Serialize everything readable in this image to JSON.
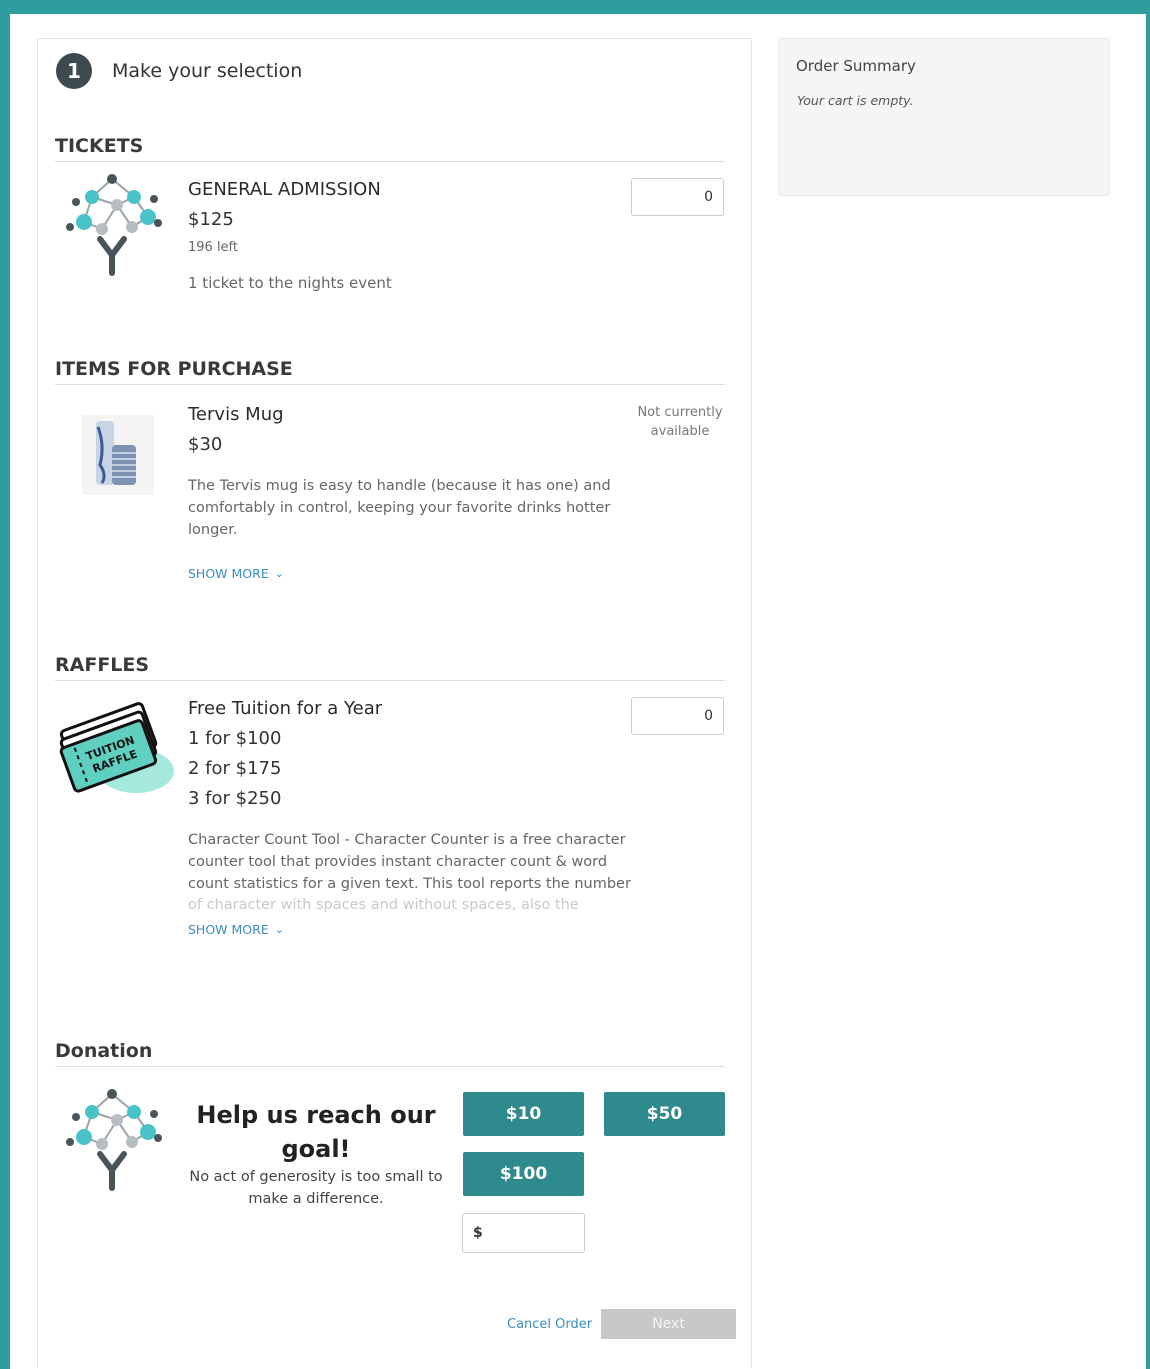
{
  "step": {
    "number": "1",
    "title": "Make your selection"
  },
  "tickets": {
    "heading": "TICKETS",
    "item": {
      "name": "GENERAL ADMISSION",
      "price": "$125",
      "remaining": "196 left",
      "description": "1 ticket to the nights event",
      "quantity": "0"
    }
  },
  "items": {
    "heading": "ITEMS FOR PURCHASE",
    "item": {
      "name": "Tervis Mug",
      "price": "$30",
      "availability_line1": "Not currently",
      "availability_line2": "available",
      "description": "The Tervis mug is easy to handle (because it has one) and comfortably in control, keeping your favorite drinks hotter longer.",
      "show_more": "SHOW MORE"
    }
  },
  "raffles": {
    "heading": "RAFFLES",
    "item": {
      "name": "Free Tuition for a Year",
      "price1": "1 for $100",
      "price2": "2 for $175",
      "price3": "3 for $250",
      "quantity": "0",
      "ticket_label1": "TUITION",
      "ticket_label2": "RAFFLE",
      "description": "Character Count Tool - Character Counter is a free character counter tool that provides instant character count & word count statistics for a given text. This tool reports the number",
      "faded_line": "of character with spaces and without spaces, also the",
      "show_more": "SHOW MORE"
    }
  },
  "donation": {
    "heading": "Donation",
    "title": "Help us reach our goal!",
    "subtitle": "No act of generosity is too small to make a difference.",
    "amounts": [
      "$10",
      "$50",
      "$100"
    ],
    "custom_prefix": "$"
  },
  "footer": {
    "cancel": "Cancel Order",
    "next": "Next"
  },
  "summary": {
    "title": "Order Summary",
    "empty": "Your cart is empty."
  },
  "colors": {
    "accent": "#2f8a8d",
    "border": "#2f9c9e",
    "link": "#3a8dbf"
  }
}
